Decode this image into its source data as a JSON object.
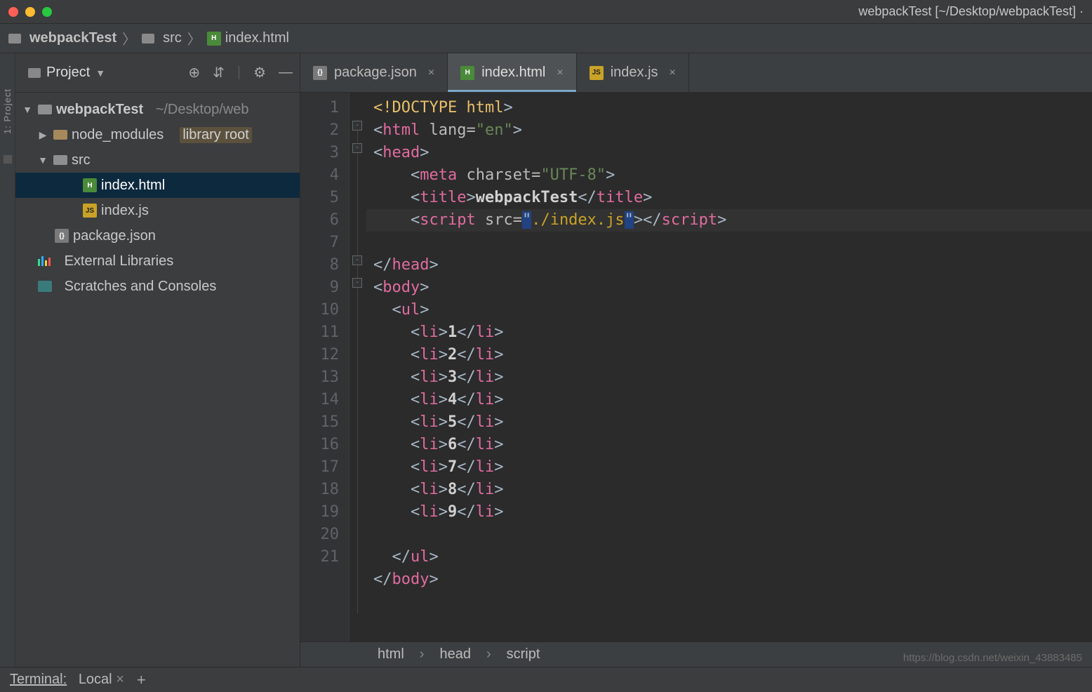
{
  "window_title": "webpackTest [~/Desktop/webpackTest] ·",
  "breadcrumb": {
    "root": "webpackTest",
    "folder": "src",
    "file": "index.html"
  },
  "project_panel_label": "Project",
  "side_tab_label": "1: Project",
  "tree": {
    "root": "webpackTest",
    "root_path": "~/Desktop/web",
    "node_modules": "node_modules",
    "library_root": "library root",
    "src": "src",
    "file_html": "index.html",
    "file_js": "index.js",
    "file_json": "package.json",
    "ext_lib": "External Libraries",
    "scratch": "Scratches and Consoles"
  },
  "tabs": [
    {
      "label": "package.json",
      "active": false,
      "icon": "json"
    },
    {
      "label": "index.html",
      "active": true,
      "icon": "html"
    },
    {
      "label": "index.js",
      "active": false,
      "icon": "js"
    }
  ],
  "gutter_lines": [
    "1",
    "2",
    "3",
    "4",
    "5",
    "6",
    "7",
    "8",
    "9",
    "10",
    "11",
    "12",
    "13",
    "14",
    "15",
    "16",
    "17",
    "18",
    "19",
    "20",
    "21"
  ],
  "code": {
    "doctype": "<!DOCTYPE ",
    "doctype_html": "html",
    "gt": ">",
    "html_open_lang": "<",
    "html": "html",
    "lang_attr": " lang=",
    "lang_val": "\"en\"",
    "head": "head",
    "charset_attr": " charset=",
    "charset_val": "\"UTF-8\"",
    "meta": "meta",
    "title": "title",
    "title_text": "webpackTest",
    "script": "script",
    "src_attr": " src=",
    "src_q": "\"",
    "src_val": "./index.js",
    "body": "body",
    "ul": "ul",
    "li": "li",
    "li_vals": [
      "1",
      "2",
      "3",
      "4",
      "5",
      "6",
      "7",
      "8",
      "9"
    ]
  },
  "breadcrumb_bottom": {
    "a": "html",
    "b": "head",
    "c": "script"
  },
  "status": {
    "terminal": "Terminal:",
    "local": "Local",
    "x": "×",
    "plus": "+"
  },
  "watermark": "https://blog.csdn.net/weixin_43883485"
}
